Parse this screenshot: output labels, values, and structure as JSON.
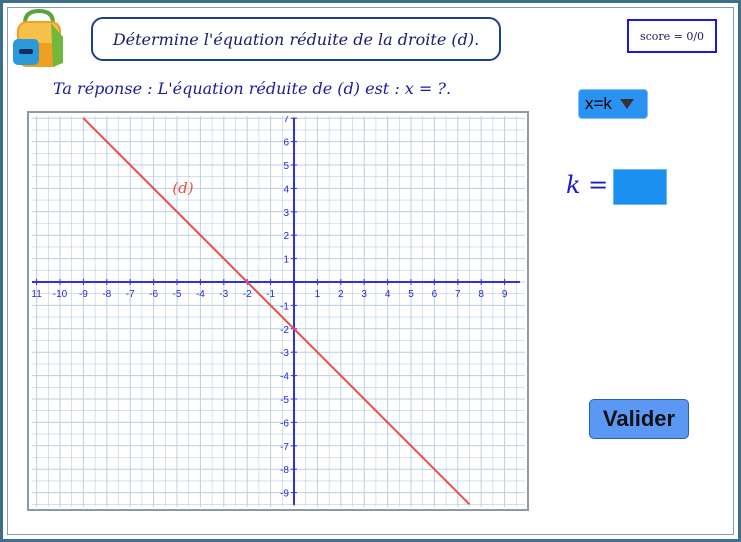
{
  "header": {
    "logo_icon": "backpack-icon",
    "title": "Détermine l'équation réduite de la droite (d).",
    "score": "score = 0/0"
  },
  "prompt": {
    "answer_text": "Ta réponse : L'équation réduite de (d) est : x = ?."
  },
  "controls": {
    "equation_form_selected": "x=k",
    "k_label": "k =",
    "k_value": "",
    "validate_label": "Valider"
  },
  "graph": {
    "line_label": "(d)",
    "line_color": "#e8504a",
    "axis_color": "#3030e0",
    "grid_color": "#b9cfe0",
    "x_range": [
      -11,
      9
    ],
    "y_range": [
      -9,
      7
    ],
    "x_ticks": [
      "11",
      "-10",
      "-9",
      "-8",
      "-7",
      "-6",
      "-5",
      "-4",
      "-3",
      "-2",
      "-1",
      "1",
      "2",
      "3",
      "4",
      "5",
      "6",
      "7",
      "8",
      "9"
    ],
    "y_ticks": [
      "7",
      "6",
      "5",
      "4",
      "3",
      "2",
      "1",
      "-1",
      "-2",
      "-3",
      "-4",
      "-5",
      "-6",
      "-7",
      "-8",
      "-9"
    ],
    "line_points": [
      [
        -9,
        7
      ],
      [
        7.5,
        -9.5
      ]
    ]
  }
}
